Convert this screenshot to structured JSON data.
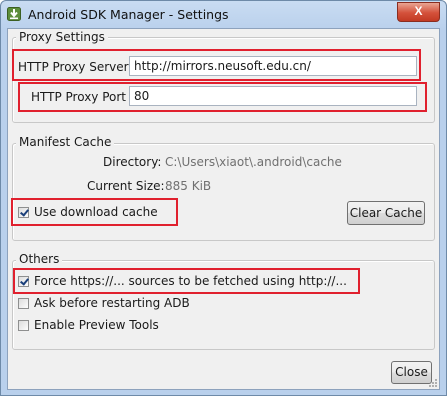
{
  "window": {
    "title": "Android SDK Manager - Settings",
    "close_glyph": "X"
  },
  "proxy": {
    "legend": "Proxy Settings",
    "server_label": "HTTP Proxy Server",
    "server_value": "http://mirrors.neusoft.edu.cn/",
    "port_label": "HTTP Proxy Port",
    "port_value": "80"
  },
  "manifest": {
    "legend": "Manifest Cache",
    "directory_label": "Directory:",
    "directory_value": "C:\\Users\\xiaot\\.android\\cache",
    "size_label": "Current Size:",
    "size_value": "885 KiB",
    "use_cache_label": "Use download cache",
    "use_cache_checked": true,
    "clear_button": "Clear Cache"
  },
  "others": {
    "legend": "Others",
    "options": [
      {
        "label": "Force https://... sources to be fetched using http://...",
        "checked": true
      },
      {
        "label": "Ask before restarting ADB",
        "checked": false
      },
      {
        "label": "Enable Preview Tools",
        "checked": false
      }
    ]
  },
  "footer": {
    "close_button": "Close"
  },
  "colors": {
    "highlight": "#e0202e",
    "title_bar": "#b9d0ec",
    "dialog_bg": "#f0f0f0"
  }
}
